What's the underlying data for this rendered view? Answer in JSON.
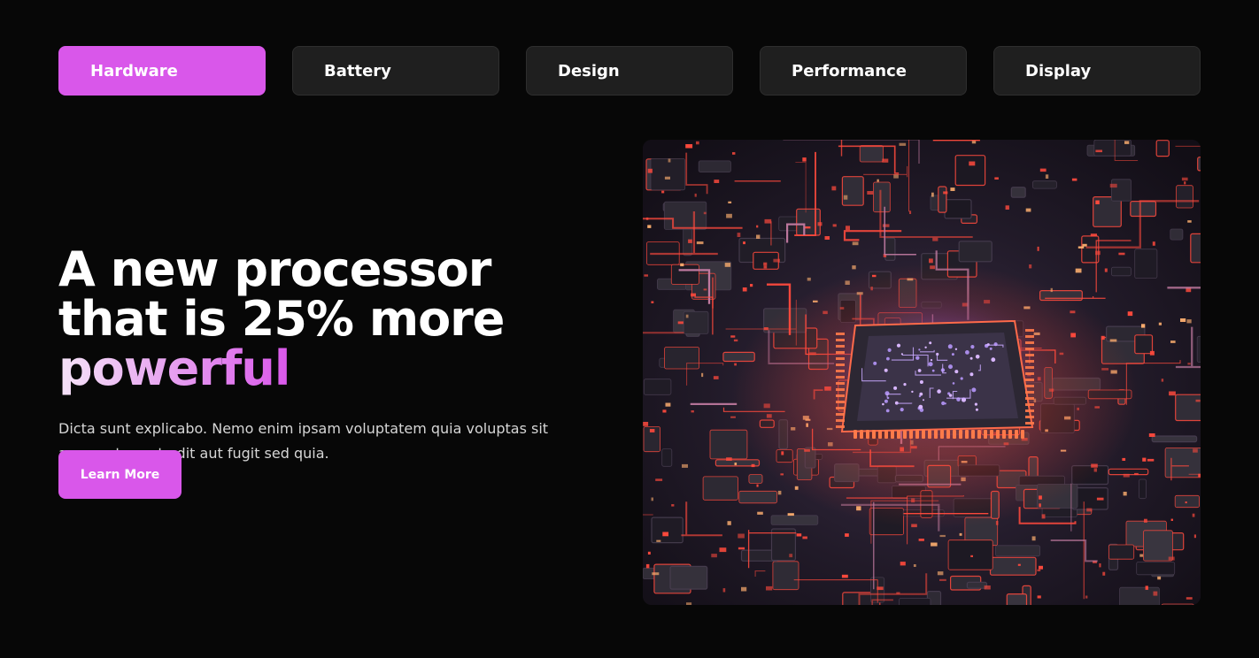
{
  "tabs": [
    {
      "label": "Hardware",
      "active": true
    },
    {
      "label": "Battery",
      "active": false
    },
    {
      "label": "Design",
      "active": false
    },
    {
      "label": "Performance",
      "active": false
    },
    {
      "label": "Display",
      "active": false
    }
  ],
  "hero": {
    "headline_main": "A new processor that is 25% more ",
    "headline_accent": "powerful",
    "description": "Dicta sunt explicabo. Nemo enim ipsam voluptatem quia voluptas sit aspernatur aut odit aut fugit sed quia.",
    "cta_label": "Learn More"
  },
  "colors": {
    "background": "#070707",
    "accent": "#d957ea",
    "tab_background": "#1f1f1f",
    "circuit_glow": "#ff4a3d"
  },
  "image": {
    "subject": "circuit-board-processor-image"
  }
}
